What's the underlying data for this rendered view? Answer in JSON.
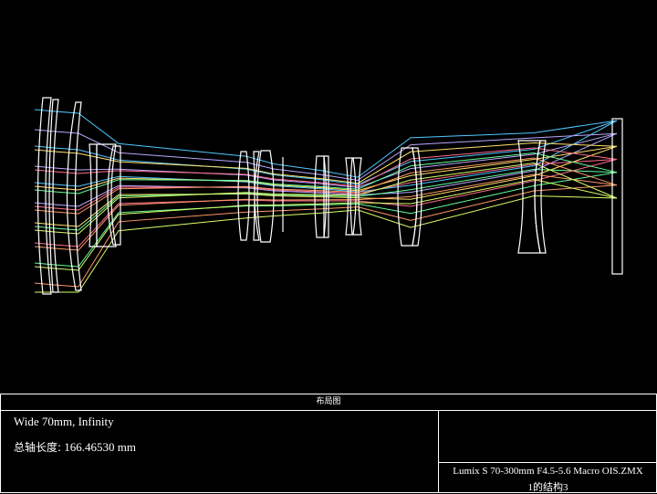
{
  "diagram": {
    "title": "布局图",
    "configuration": "Wide 70mm, Infinity",
    "total_length_label": "总轴长度:",
    "total_length_value": "166.46530 mm",
    "file_name": "Lumix S 70-300mm F4.5-5.6 Macro OIS.ZMX",
    "config_name": "1的结构3"
  },
  "colors": {
    "background": "#000000",
    "lens_outline": "#ffffff",
    "ray_fields": [
      "#4fc8ff",
      "#b9a6ff",
      "#ffe066",
      "#ff6b8a",
      "#66ff99",
      "#ff9966",
      "#d9ff66"
    ]
  }
}
